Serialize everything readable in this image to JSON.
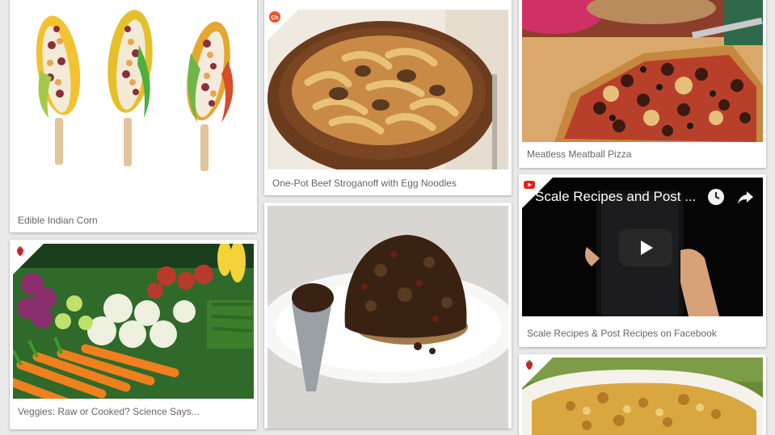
{
  "cards": {
    "corn": {
      "caption": "Edible Indian Corn"
    },
    "veggies": {
      "caption": "Veggies: Raw or Cooked? Science Says..."
    },
    "stroganoff": {
      "caption": "One-Pot Beef Stroganoff with Egg Noodles",
      "source_icon": "ch-icon",
      "source_text": "Ch"
    },
    "pudding": {
      "caption": ""
    },
    "pizza": {
      "caption": "Meatless Meatball Pizza"
    },
    "video": {
      "caption": "Scale Recipes & Post Recipes on Facebook",
      "video_title": "Scale Recipes and Post ...",
      "source_icon": "youtube-icon"
    },
    "gratin": {
      "caption": ""
    }
  },
  "colors": {
    "youtube_red": "#e62117",
    "ch_orange": "#e8542c",
    "strawberry": "#d21e2b"
  }
}
